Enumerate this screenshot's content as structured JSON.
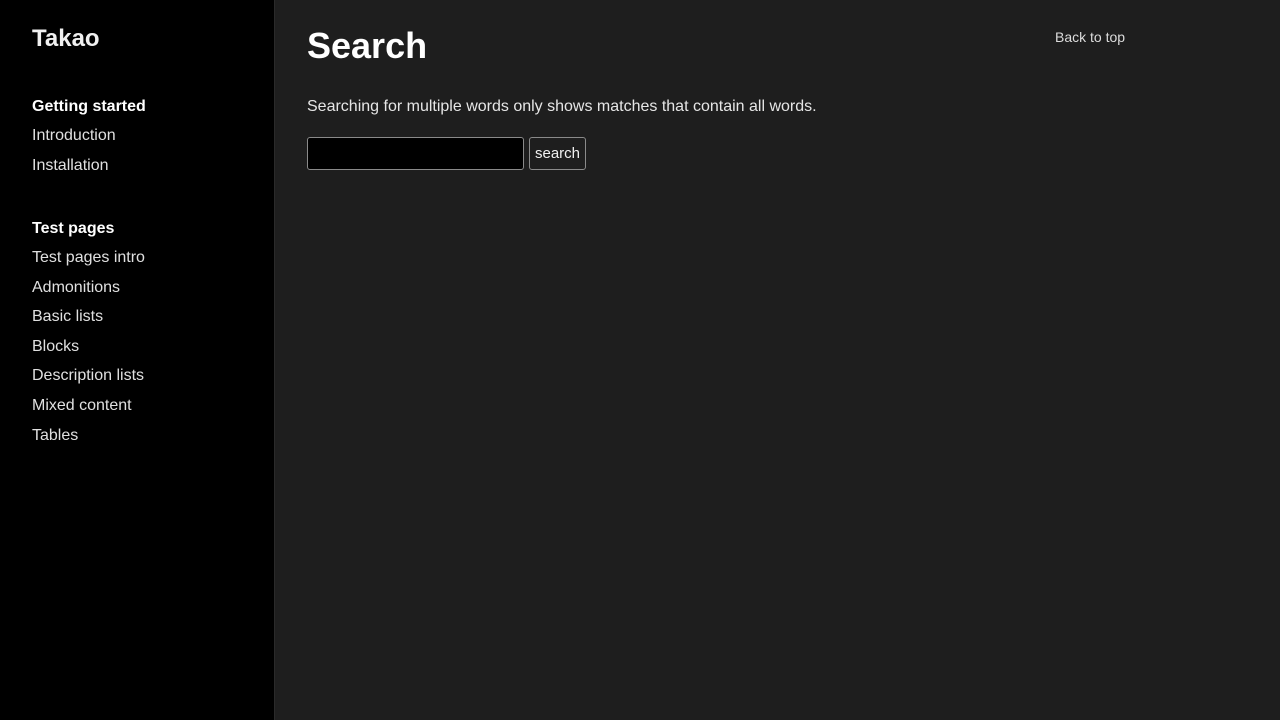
{
  "sidebar": {
    "site_title": "Takao",
    "sections": [
      {
        "heading": "Getting started",
        "items": [
          "Introduction",
          "Installation"
        ]
      },
      {
        "heading": "Test pages",
        "items": [
          "Test pages intro",
          "Admonitions",
          "Basic lists",
          "Blocks",
          "Description lists",
          "Mixed content",
          "Tables"
        ]
      }
    ]
  },
  "main": {
    "title": "Search",
    "back_to_top": "Back to top",
    "intro": "Searching for multiple words only shows matches that contain all words.",
    "search": {
      "value": "",
      "placeholder": "",
      "button_label": "search"
    }
  },
  "colors": {
    "sidebar_bg": "#000000",
    "main_bg": "#1e1e1e",
    "text": "#e6e6e6"
  }
}
